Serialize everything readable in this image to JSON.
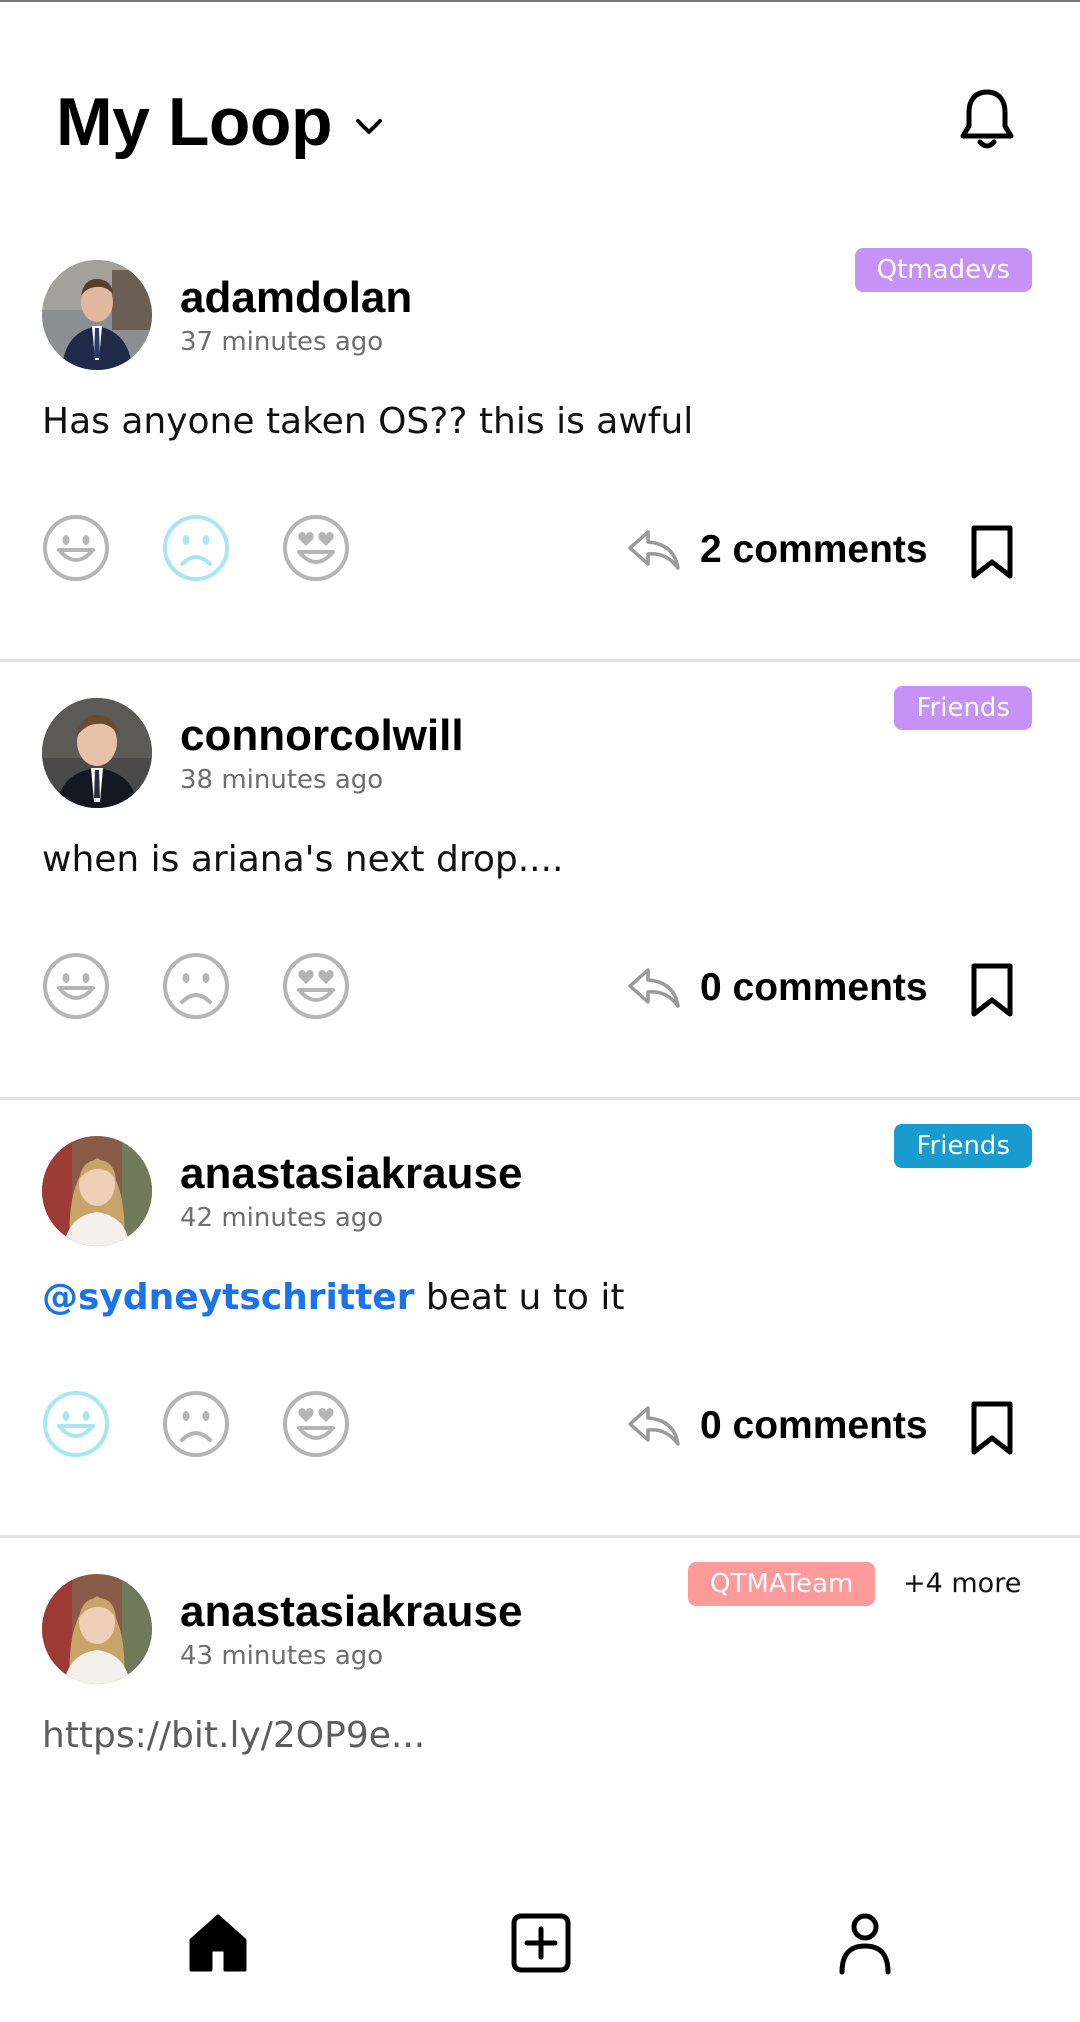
{
  "header": {
    "title": "My Loop",
    "chevron_icon": "chevron-down-icon",
    "bell_icon": "bell-icon"
  },
  "colors": {
    "tag_purple": "#c792f5",
    "tag_blue": "#1a9bd0",
    "tag_red": "#ff9a9a",
    "reaction_active": "#a8e6f5",
    "reaction_inactive": "#b5b5b5",
    "mention": "#1a73e8"
  },
  "posts": [
    {
      "username": "adamdolan",
      "time": "37 minutes ago",
      "tag": "Qtmadevs",
      "tag_color": "purple",
      "content": "Has anyone taken OS?? this is awful",
      "comments": "2 comments",
      "reactions": {
        "happy": "inactive",
        "sad": "active",
        "love": "inactive"
      }
    },
    {
      "username": "connorcolwill",
      "time": "38 minutes ago",
      "tag": "Friends",
      "tag_color": "purple",
      "content": "when is ariana's next drop....",
      "comments": "0 comments",
      "reactions": {
        "happy": "inactive",
        "sad": "inactive",
        "love": "inactive"
      }
    },
    {
      "username": "anastasiakrause",
      "time": "42 minutes ago",
      "tag": "Friends",
      "tag_color": "blue",
      "mention": "@sydneytschritter",
      "content": " beat u to it",
      "comments": "0 comments",
      "reactions": {
        "happy": "active",
        "sad": "inactive",
        "love": "inactive"
      }
    },
    {
      "username": "anastasiakrause",
      "time": "43 minutes ago",
      "tag": "QTMATeam",
      "tag_color": "red",
      "more": "+4 more",
      "content": "https://bit.ly/2OP9e..."
    }
  ],
  "tabbar": {
    "items": [
      "home-icon",
      "add-post-icon",
      "profile-icon"
    ]
  }
}
